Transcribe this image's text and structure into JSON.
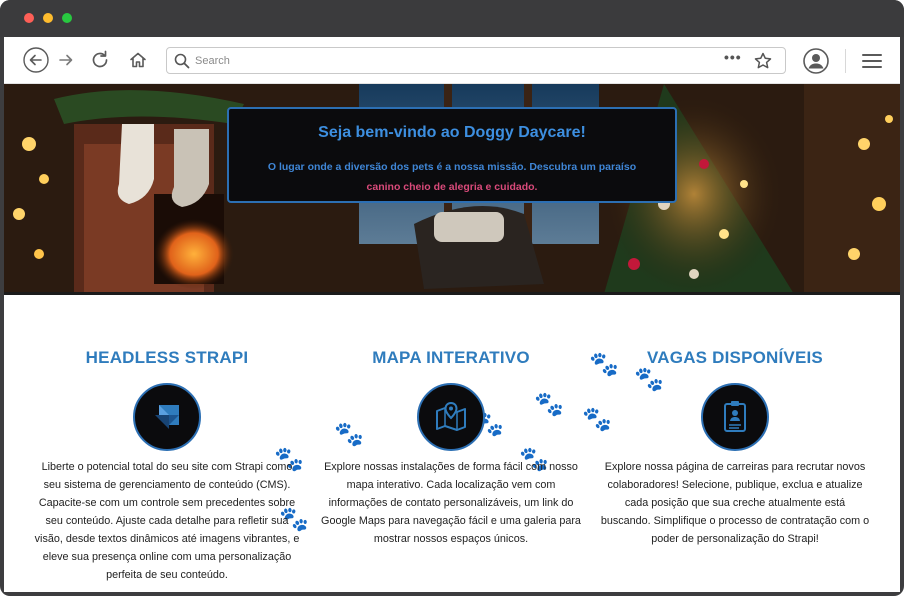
{
  "browser": {
    "search_placeholder": "Search",
    "more_label": "•••"
  },
  "hero": {
    "title": "Seja bem-vindo ao Doggy Daycare!",
    "text_main": "O lugar onde a diversão dos pets é a nossa missão. Descubra um paraíso",
    "text_accent": "canino cheio de alegria e cuidado."
  },
  "features": [
    {
      "title": "HEADLESS STRAPI",
      "icon": "strapi-logo-icon",
      "text": "Liberte o potencial total do seu site com Strapi como seu sistema de gerenciamento de conteúdo (CMS). Capacite-se com um controle sem precedentes sobre seu conteúdo. Ajuste cada detalhe para refletir sua visão, desde textos dinâmicos até imagens vibrantes, e eleve sua presença online com uma personalização perfeita de seu conteúdo."
    },
    {
      "title": "MAPA INTERATIVO",
      "icon": "map-pin-icon",
      "text": "Explore nossas instalações de forma fácil com nosso mapa interativo. Cada localização vem com informações de contato personalizáveis, um link do Google Maps para navegação fácil e uma galeria para mostrar nossos espaços únicos."
    },
    {
      "title": "VAGAS DISPONÍVEIS",
      "icon": "clipboard-user-icon",
      "text": "Explore nossa página de carreiras para recrutar novos colaboradores! Selecione, publique, exclua e atualize cada posição que sua creche atualmente está buscando. Simplifique o processo de contratação com o poder de personalização do Strapi!"
    }
  ],
  "colors": {
    "accent": "#2f7cbd",
    "hero_box_bg": "#0b0b0d",
    "hero_accent_text": "#d94a7a"
  }
}
